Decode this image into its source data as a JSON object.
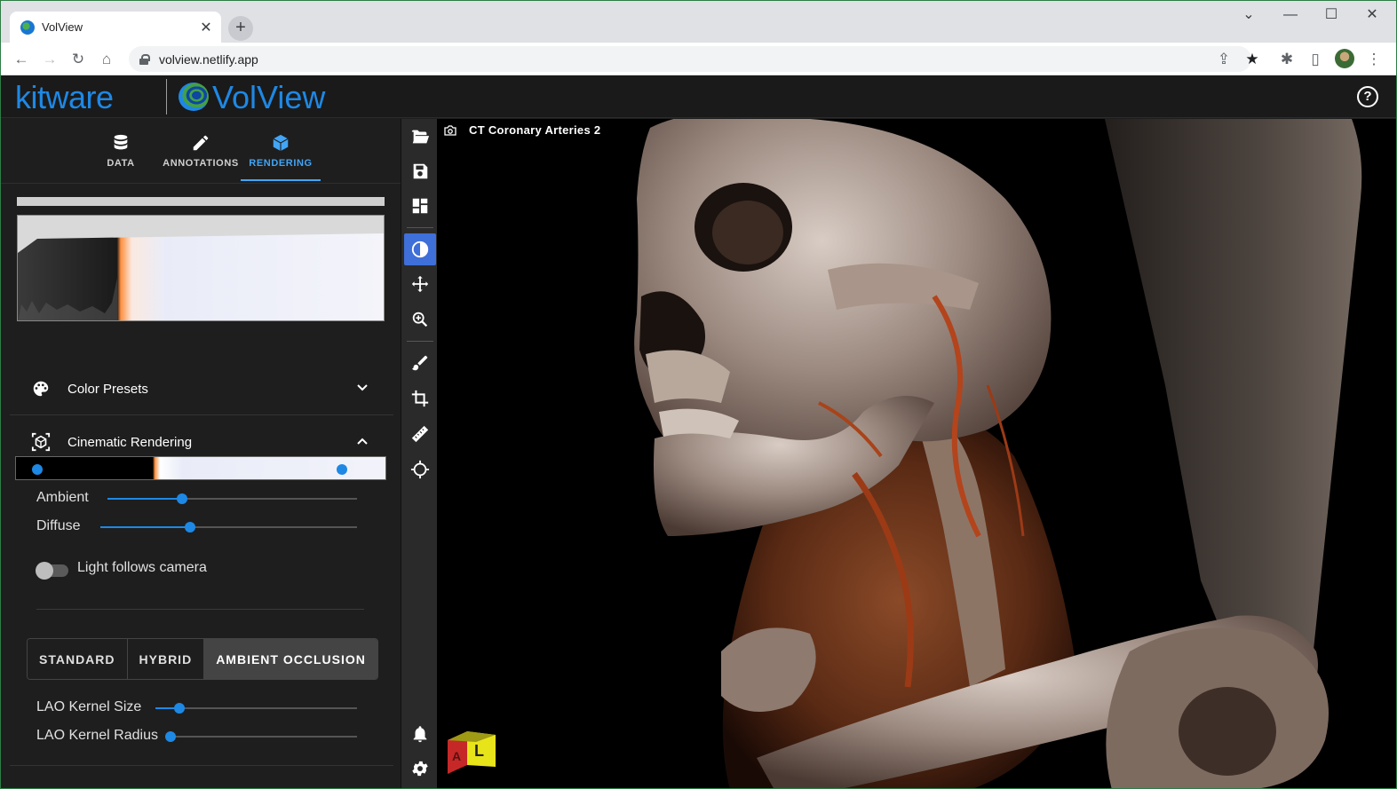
{
  "browser": {
    "tab_title": "VolView",
    "tab_close": "✕",
    "new_tab": "+",
    "url": "volview.netlify.app",
    "window_controls": {
      "chevron": "⌄",
      "minimize": "—",
      "maximize": "☐",
      "close": "✕"
    }
  },
  "header": {
    "kitware_logo": "kitware",
    "volview_logo": "VolView",
    "help_icon": "?"
  },
  "panel_tabs": [
    {
      "label": "DATA",
      "icon": "database-icon"
    },
    {
      "label": "ANNOTATIONS",
      "icon": "pencil-icon"
    },
    {
      "label": "RENDERING",
      "icon": "cube-icon",
      "active": true
    }
  ],
  "transfer_function": {
    "colors": {
      "shadow": "#000000",
      "accent": "#ff9040",
      "bright": "#f2f3fa"
    },
    "left_handle": 0.06,
    "right_handle": 0.88
  },
  "sections": {
    "color_presets": "Color Presets",
    "cinematic_rendering": "Cinematic Rendering"
  },
  "sliders": {
    "ambient": {
      "label": "Ambient",
      "value": 0.3
    },
    "diffuse": {
      "label": "Diffuse",
      "value": 0.35
    },
    "lao_kernel_size": {
      "label": "LAO Kernel Size",
      "value": 0.12
    },
    "lao_kernel_radius": {
      "label": "LAO Kernel Radius",
      "value": 0.0
    }
  },
  "light_follows_camera": {
    "label": "Light follows camera",
    "on": false
  },
  "shading_modes": [
    "STANDARD",
    "HYBRID",
    "AMBIENT OCCLUSION"
  ],
  "shading_selected": "AMBIENT OCCLUSION",
  "toolbar": [
    "folder-open-icon",
    "save-icon",
    "layout-icon",
    "window-level-icon",
    "pan-icon",
    "zoom-icon",
    "paint-icon",
    "crop-icon",
    "ruler-icon",
    "crosshair-icon",
    "bell-icon",
    "settings-icon"
  ],
  "viewport": {
    "title": "CT Coronary Arteries 2",
    "orientation_cube": {
      "front": "L",
      "side": "A"
    }
  },
  "colors": {
    "accent": "#1e88e5",
    "active_tool": "#3f6fd8"
  }
}
